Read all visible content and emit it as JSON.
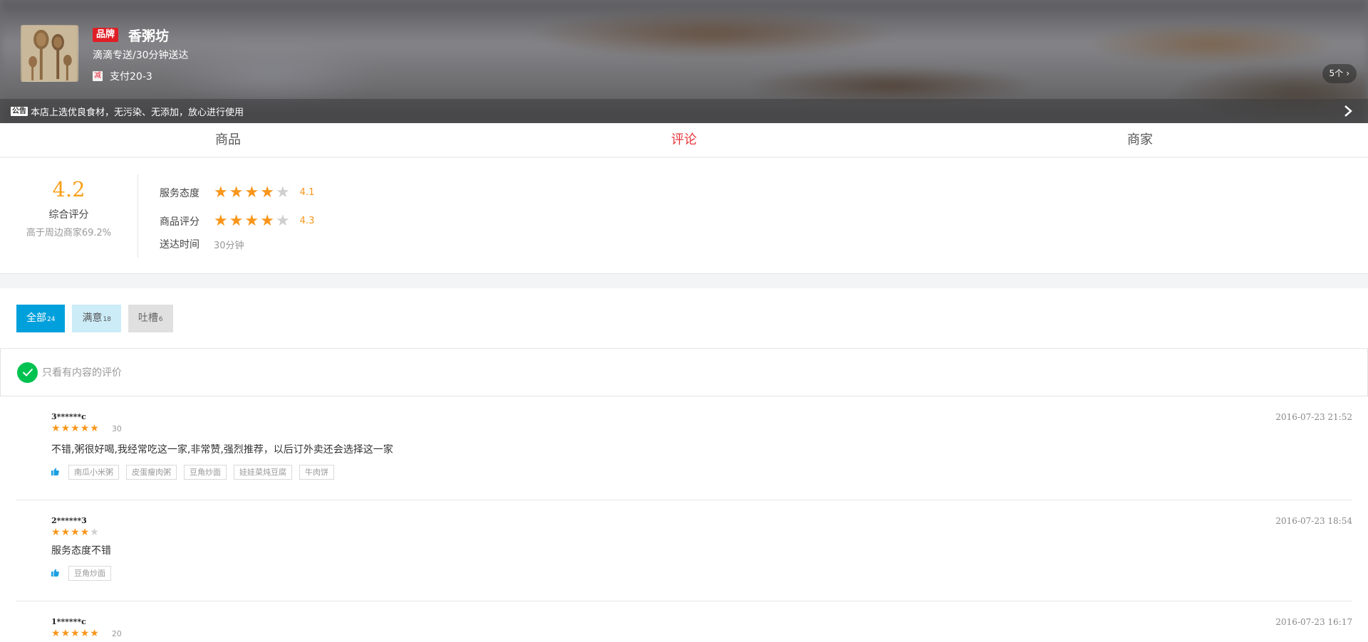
{
  "shop": {
    "brand_badge": "品牌",
    "name": "香粥坊",
    "delivery": "滴滴专送/30分钟送达",
    "promo_icon": "减",
    "promo_text": "支付20-3",
    "promo_count": "5个",
    "notice_tag": "公告",
    "notice_text": "本店上选优良食材，无污染、无添加，放心进行使用",
    "logo_icon": "wooden-spoons-icon"
  },
  "tabs": [
    {
      "label": "商品",
      "active": false
    },
    {
      "label": "评论",
      "active": true
    },
    {
      "label": "商家",
      "active": false
    }
  ],
  "summary": {
    "score": "4.2",
    "score_label": "综合评分",
    "score_compare": "高于周边商家69.2%",
    "service": {
      "label": "服务态度",
      "value": "4.1",
      "stars": 4
    },
    "goods": {
      "label": "商品评分",
      "value": "4.3",
      "stars": 4
    },
    "delivery": {
      "label": "送达时间",
      "value": "30分钟"
    }
  },
  "filters": [
    {
      "label": "全部",
      "count": "24"
    },
    {
      "label": "满意",
      "count": "18"
    },
    {
      "label": "吐槽",
      "count": "6"
    }
  ],
  "only_content_label": "只看有内容的评价",
  "colors": {
    "accent": "#00a0dc",
    "active_tab": "#e8353b",
    "star": "#f8961b",
    "brand": "#e01e26",
    "check": "#00c250"
  },
  "reviews": [
    {
      "user": "3******c",
      "time": "2016-07-23 21:52",
      "stars": 5,
      "minutes": "30",
      "text": "不错,粥很好喝,我经常吃这一家,非常赞,强烈推荐，以后订外卖还会选择这一家",
      "tags": [
        "南瓜小米粥",
        "皮蛋瘦肉粥",
        "豆角炒面",
        "娃娃菜炖豆腐",
        "牛肉饼"
      ]
    },
    {
      "user": "2******3",
      "time": "2016-07-23 18:54",
      "stars": 4,
      "minutes": "",
      "text": "服务态度不错",
      "tags": [
        "豆角炒面"
      ]
    },
    {
      "user": "1******c",
      "time": "2016-07-23 16:17",
      "stars": 5,
      "minutes": "20",
      "text": "",
      "tags": []
    }
  ]
}
